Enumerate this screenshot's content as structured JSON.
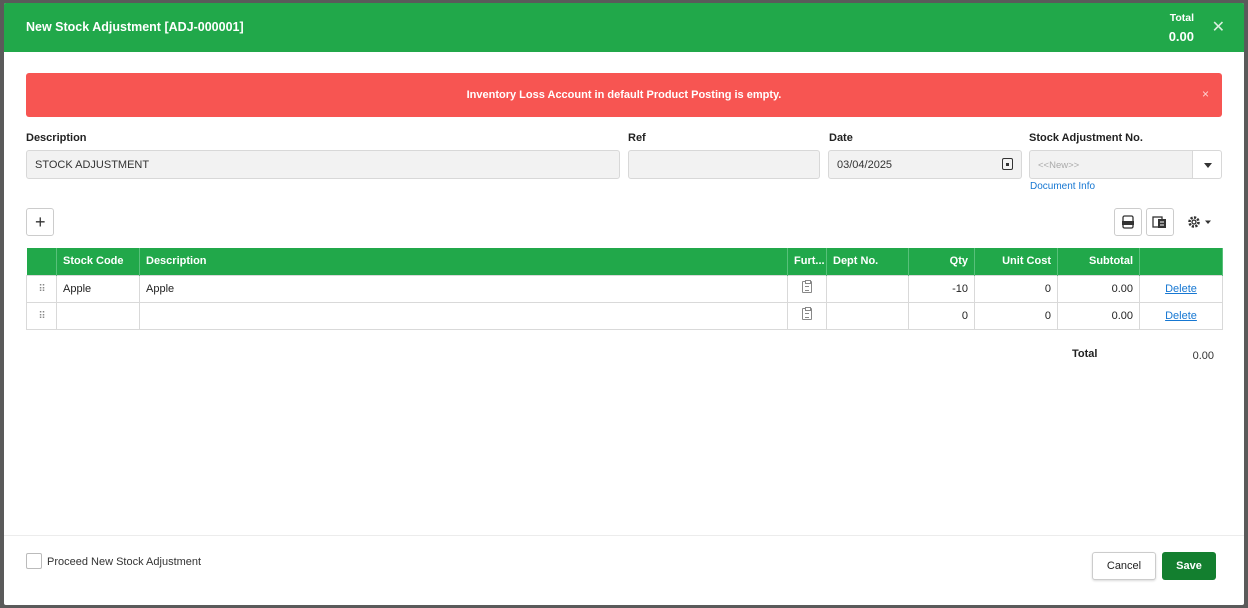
{
  "header": {
    "title": "New Stock Adjustment [ADJ-000001]",
    "total_label": "Total",
    "total_value": "0.00",
    "close": "✕"
  },
  "alert": {
    "message": "Inventory Loss Account in default Product Posting is empty.",
    "close": "×"
  },
  "form": {
    "description_label": "Description",
    "description_value": "STOCK ADJUSTMENT",
    "ref_label": "Ref",
    "ref_value": "",
    "date_label": "Date",
    "date_value": "03/04/2025",
    "docno_label": "Stock Adjustment No.",
    "docno_placeholder": "<<New>>",
    "document_info": "Document Info"
  },
  "grid": {
    "columns": [
      "",
      "Stock Code",
      "Description",
      "Furt...",
      "Dept No.",
      "Qty",
      "Unit Cost",
      "Subtotal",
      ""
    ],
    "rows": [
      {
        "stock_code": "Apple",
        "description": "Apple",
        "dept": "",
        "qty": "-10",
        "unit_cost": "0",
        "subtotal": "0.00",
        "action": "Delete"
      },
      {
        "stock_code": "",
        "description": "",
        "dept": "",
        "qty": "0",
        "unit_cost": "0",
        "subtotal": "0.00",
        "action": "Delete"
      }
    ]
  },
  "summary": {
    "total_label": "Total",
    "total_value": "0.00"
  },
  "footer": {
    "proceed_label": "Proceed New Stock Adjustment",
    "cancel": "Cancel",
    "save": "Save"
  },
  "colors": {
    "header": "#21a84a",
    "alert": "#f75552",
    "save": "#137f2f",
    "link": "#1677d2"
  }
}
